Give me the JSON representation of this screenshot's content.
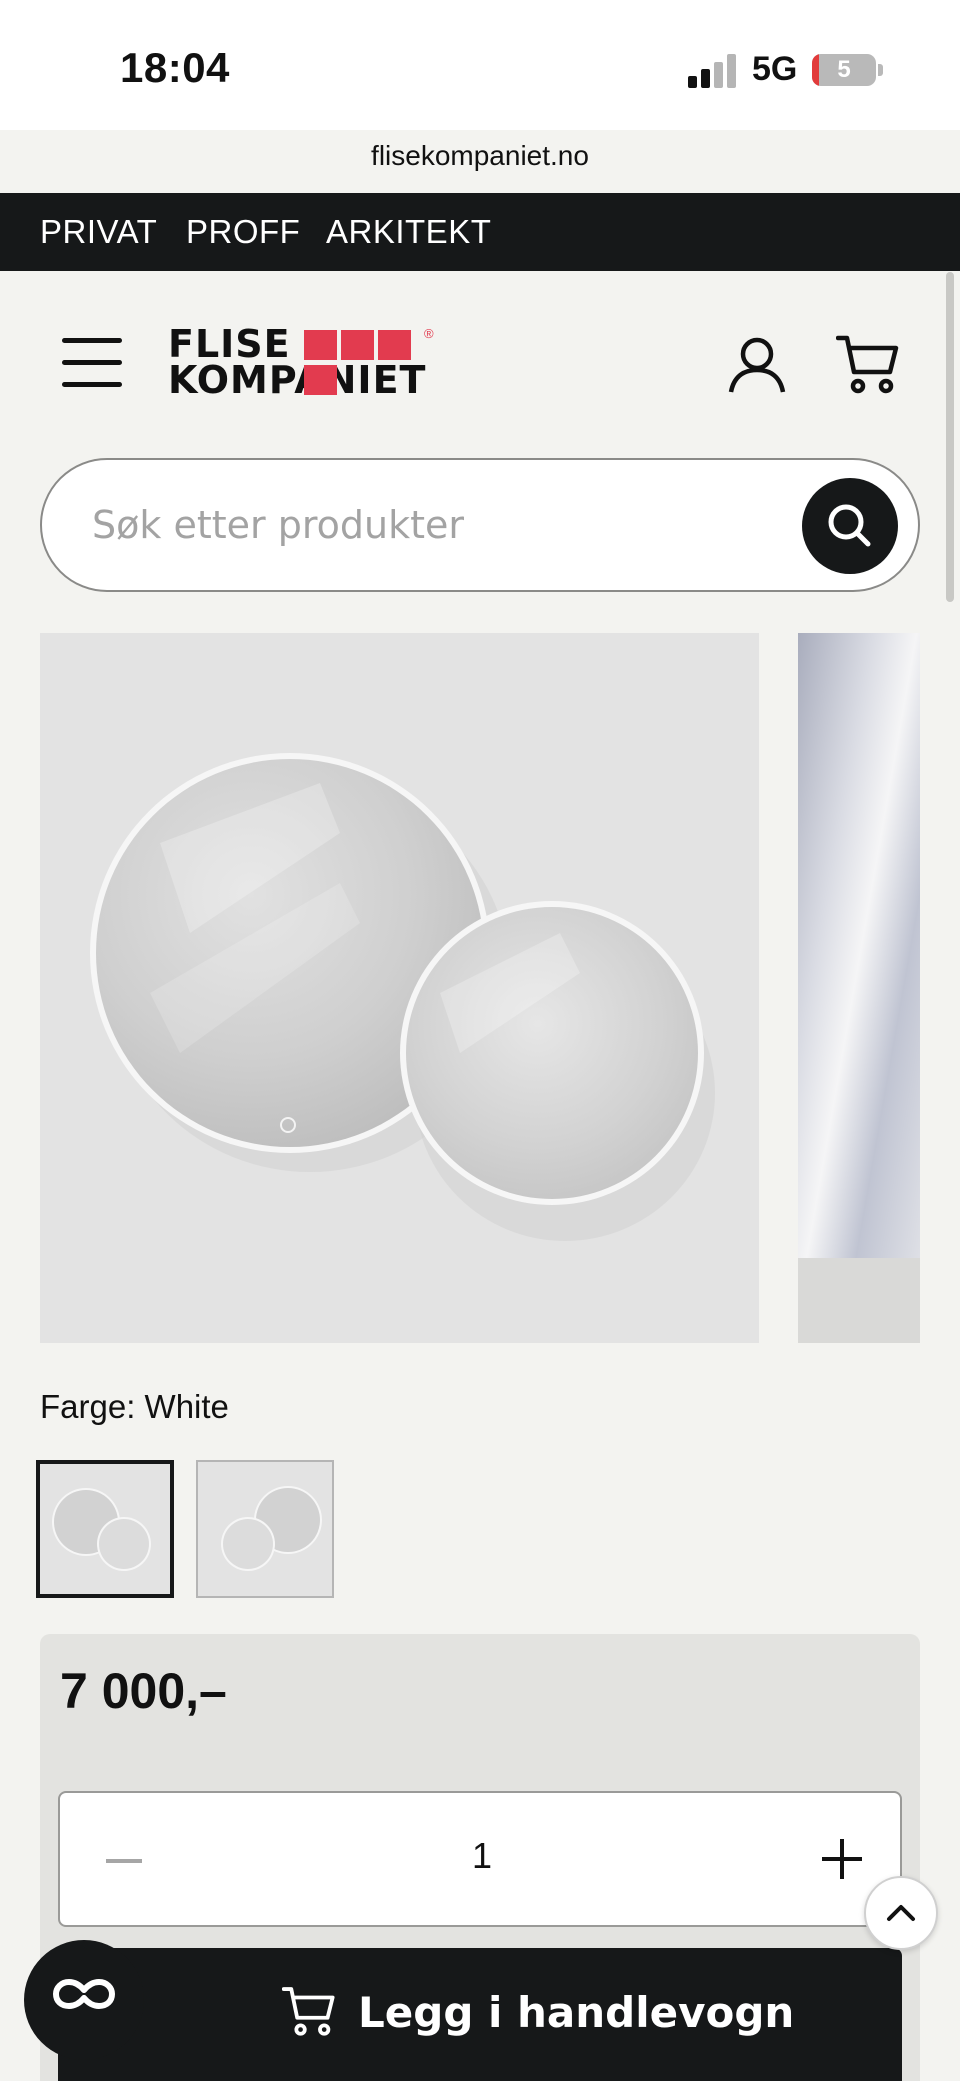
{
  "status_bar": {
    "time": "18:04",
    "network": "5G",
    "battery": "5"
  },
  "browser": {
    "url": "flisekompaniet.no"
  },
  "top_nav": {
    "items": [
      "PRIVAT",
      "PROFF",
      "ARKITEKT"
    ]
  },
  "header": {
    "logo_line1": "FLISE",
    "logo_line2": "KOMPANIET",
    "logo_reg": "®"
  },
  "search": {
    "placeholder": "Søk etter produkter"
  },
  "product": {
    "color_label": "Farge: White",
    "price": "7 000,–",
    "quantity": "1",
    "add_to_cart_label": "Legg i handlevogn"
  },
  "colors": {
    "accent": "#e23b4f",
    "dark": "#161819",
    "background": "#f3f3f0"
  }
}
